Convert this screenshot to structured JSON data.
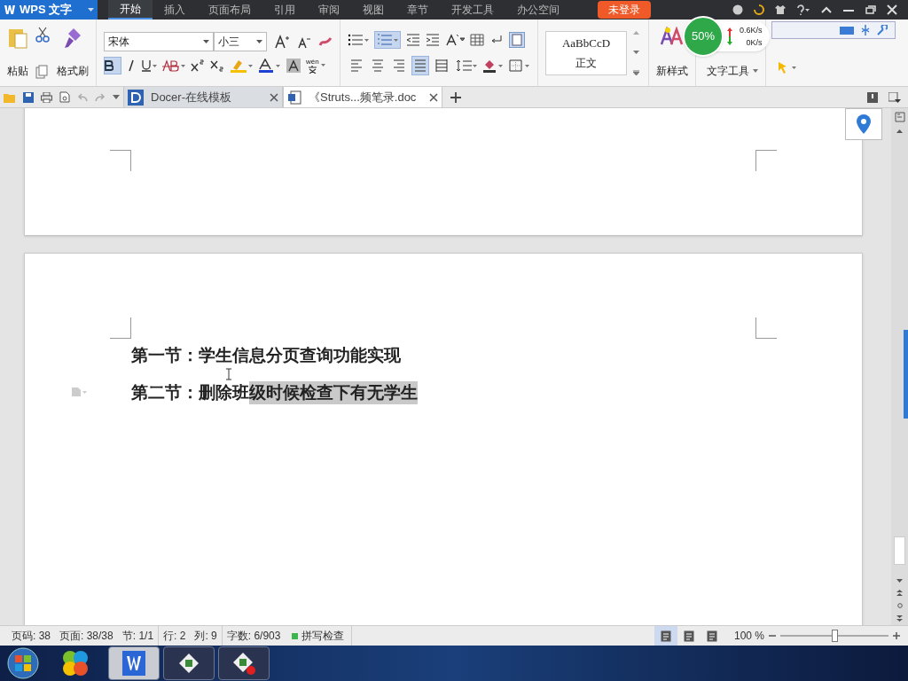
{
  "app_menu": {
    "label": "WPS 文字"
  },
  "menu_tabs": [
    {
      "label": "开始",
      "selected": true
    },
    {
      "label": "插入",
      "selected": false
    },
    {
      "label": "页面布局",
      "selected": false
    },
    {
      "label": "引用",
      "selected": false
    },
    {
      "label": "审阅",
      "selected": false
    },
    {
      "label": "视图",
      "selected": false
    },
    {
      "label": "章节",
      "selected": false
    },
    {
      "label": "开发工具",
      "selected": false
    },
    {
      "label": "办公空间",
      "selected": false
    }
  ],
  "login_button": {
    "label": "未登录"
  },
  "network_widget": {
    "percent": "50%",
    "upload": "0.6K/s",
    "download": "0K/s"
  },
  "ribbon": {
    "paste": "粘贴",
    "format_painter": "格式刷",
    "font": "宋体",
    "font_size": "小三",
    "bold": true,
    "numbering": true,
    "pinyin": "wén",
    "alignments": [
      {
        "selected": false
      },
      {
        "selected": false
      },
      {
        "selected": false
      },
      {
        "selected": true
      },
      {
        "selected": false
      }
    ],
    "style_preview": "AaBbCcD",
    "style_name": "正文",
    "new_style": "新样式",
    "text_tools": "文字工具"
  },
  "doc_tabs": [
    {
      "label": "Docer-在线模板",
      "selected": false
    },
    {
      "label": "《Struts...频笔录.doc",
      "selected": true
    }
  ],
  "document": {
    "lines": [
      {
        "segments": [
          {
            "text": "第一节：学生信息分页查询功能实现",
            "selected": false
          }
        ]
      },
      {
        "segments": [
          {
            "text": "第二节：删除班",
            "selected": false
          },
          {
            "text": "级时候检查下有无学生",
            "selected": true
          }
        ]
      }
    ]
  },
  "status_bar": {
    "fields": [
      "页码: 38",
      "页面: 38/38",
      "节: 1/1",
      "行: 2",
      "列: 9",
      "字数: 6/903"
    ],
    "spell_check": "拼写检查",
    "views": [
      {
        "selected": true
      },
      {
        "selected": false
      },
      {
        "selected": false
      }
    ],
    "zoom": "100 %",
    "zoom_slider": {
      "level": 0.5
    }
  },
  "taskbar": [
    {
      "kind": "wps",
      "selected": true
    },
    {
      "kind": "app",
      "selected": false
    },
    {
      "kind": "app-stop",
      "selected": false
    }
  ]
}
